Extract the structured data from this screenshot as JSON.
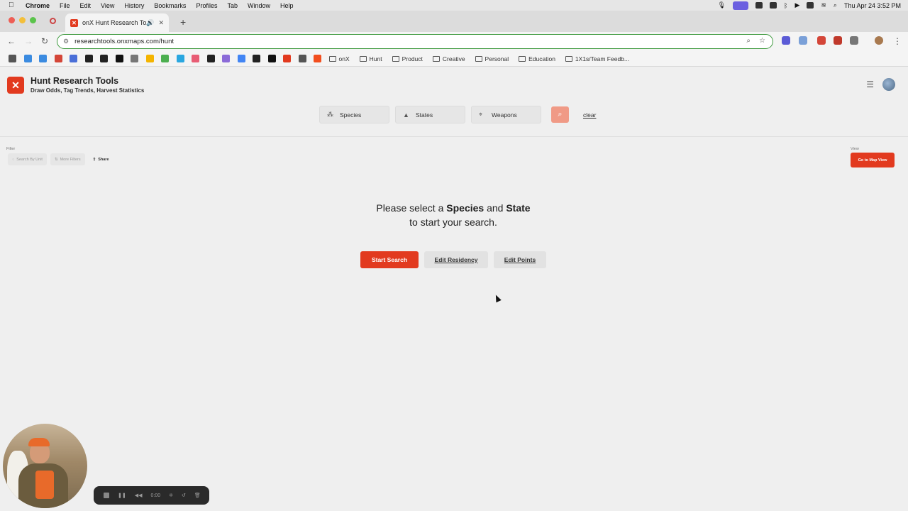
{
  "menubar": {
    "app": "Chrome",
    "items": [
      "File",
      "Edit",
      "View",
      "History",
      "Bookmarks",
      "Profiles",
      "Tab",
      "Window",
      "Help"
    ],
    "clock": "Thu Apr 24  3:52 PM"
  },
  "browser": {
    "tab_title": "onX Hunt Research Tools",
    "url": "researchtools.onxmaps.com/hunt",
    "bookmark_folders": [
      "onX",
      "Hunt",
      "Product",
      "Creative",
      "Personal",
      "Education",
      "1X1s/Team Feedb..."
    ],
    "bookmark_icon_colors": [
      "#555555",
      "#3b8be0",
      "#d44638",
      "#4a6fd8",
      "#222222",
      "#222222",
      "#111111",
      "#777777",
      "#888888",
      "#4caf50",
      "#f4b400",
      "#2aa7e0",
      "#e85d75",
      "#222222",
      "#8b6bd8",
      "#4285f4",
      "#222222",
      "#111111",
      "#e23a1f",
      "#555555",
      "#f24e1e"
    ]
  },
  "app": {
    "logo_glyph": "✕",
    "title": "Hunt Research Tools",
    "subtitle": "Draw Odds, Tag Trends, Harvest Statistics",
    "accent": "#e23a1f"
  },
  "selectors": {
    "species": "Species",
    "states": "States",
    "weapons": "Weapons",
    "clear": "clear"
  },
  "filter": {
    "label": "Filter",
    "search_by_unit": "Search By Unit",
    "more_filters": "More Filters",
    "share": "Share"
  },
  "view": {
    "label": "View",
    "map_button": "Go to Map View"
  },
  "prompt": {
    "pre": "Please select a",
    "species": "Species",
    "and": "and",
    "state": "State",
    "line2": "to start your search."
  },
  "actions": {
    "start": "Start Search",
    "residency": "Edit Residency",
    "points": "Edit Points"
  },
  "recorder": {
    "time": "0:00"
  }
}
